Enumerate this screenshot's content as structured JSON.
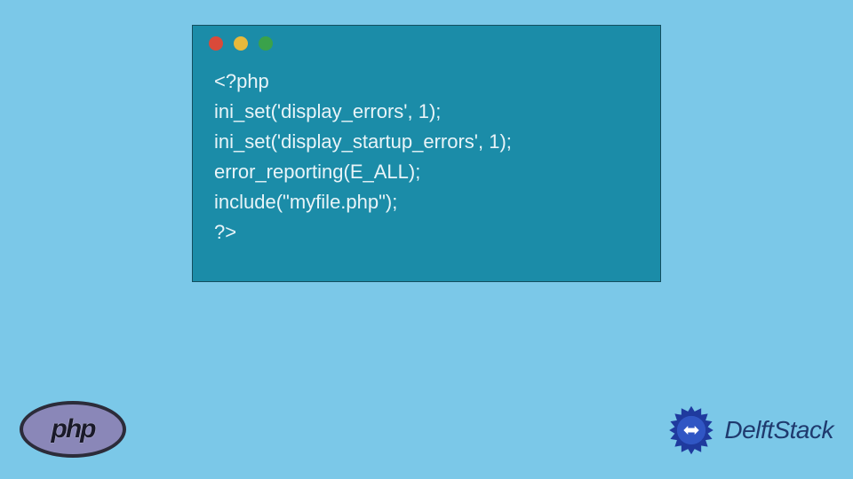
{
  "code": {
    "lines": [
      "<?php",
      "ini_set('display_errors', 1);",
      "ini_set('display_startup_errors', 1);",
      "error_reporting(E_ALL);",
      "include(\"myfile.php\");",
      "?>"
    ]
  },
  "php_logo": {
    "text": "php"
  },
  "delft_logo": {
    "text": "DelftStack"
  }
}
